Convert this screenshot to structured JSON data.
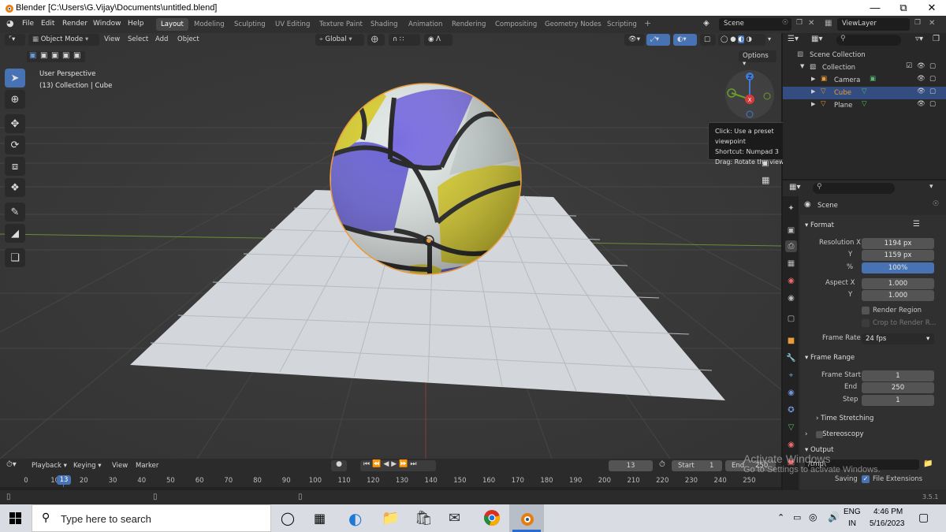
{
  "window": {
    "title": "Blender [C:\\Users\\G.Vijay\\Documents\\untitled.blend]"
  },
  "menu": [
    "File",
    "Edit",
    "Render",
    "Window",
    "Help"
  ],
  "workspaces": [
    "Layout",
    "Modeling",
    "Sculpting",
    "UV Editing",
    "Texture Paint",
    "Shading",
    "Animation",
    "Rendering",
    "Compositing",
    "Geometry Nodes",
    "Scripting"
  ],
  "active_workspace": "Layout",
  "scene_name": "Scene",
  "view_layer": "ViewLayer",
  "viewport": {
    "mode": "Object Mode",
    "menus": [
      "View",
      "Select",
      "Add",
      "Object"
    ],
    "transform_orientation": "Global",
    "options_label": "Options",
    "view_name": "User Perspective",
    "collection_info": "(13) Collection | Cube",
    "gizmo": {
      "x": "X",
      "y": "Y",
      "z": "Z"
    },
    "tooltip": [
      "Click: Use a preset viewpoint",
      "Shortcut: Numpad 3",
      "Drag: Rotate the view"
    ]
  },
  "outliner": {
    "rows": [
      {
        "label": "Scene Collection",
        "selected": false
      },
      {
        "label": "Collection",
        "selected": false
      },
      {
        "label": "Camera",
        "selected": false
      },
      {
        "label": "Cube",
        "selected": true
      },
      {
        "label": "Plane",
        "selected": false
      }
    ]
  },
  "properties": {
    "context": "Scene",
    "format_label": "Format",
    "resolution_x_label": "Resolution X",
    "resolution_x": "1194 px",
    "resolution_y_label": "Y",
    "resolution_y": "1159 px",
    "percent_label": "%",
    "percent": "100%",
    "aspect_x_label": "Aspect X",
    "aspect_x": "1.000",
    "aspect_y_label": "Y",
    "aspect_y": "1.000",
    "render_region": "Render Region",
    "crop_region": "Crop to Render R...",
    "frame_rate_label": "Frame Rate",
    "frame_rate": "24 fps",
    "frame_range_label": "Frame Range",
    "frame_start_label": "Frame Start",
    "frame_start": "1",
    "frame_end_label": "End",
    "frame_end": "250",
    "step_label": "Step",
    "step": "1",
    "time_stretching": "Time Stretching",
    "stereoscopy": "Stereoscopy",
    "output_label": "Output",
    "output_path": "/tmp\\",
    "saving_label": "Saving",
    "file_extensions": "File Extensions"
  },
  "timeline": {
    "menus": [
      "Playback",
      "Keying",
      "View",
      "Marker"
    ],
    "current_frame": "13",
    "start_label": "Start",
    "start": "1",
    "end_label": "End",
    "end": "250",
    "ticks": [
      "0",
      "10",
      "20",
      "30",
      "40",
      "50",
      "60",
      "70",
      "80",
      "90",
      "100",
      "110",
      "120",
      "130",
      "140",
      "150",
      "160",
      "170",
      "180",
      "190",
      "200",
      "210",
      "220",
      "230",
      "240",
      "250"
    ],
    "playhead": "13"
  },
  "status": {
    "version": "3.5.1"
  },
  "watermark": {
    "line1": "Activate Windows",
    "line2": "Go to Settings to activate Windows."
  },
  "taskbar": {
    "search_placeholder": "Type here to search",
    "lang": "ENG",
    "region": "IN",
    "time": "4:46 PM",
    "date": "5/16/2023"
  },
  "colors": {
    "accent": "#4772b3",
    "selection": "#334d80",
    "origin": "#e89b3c"
  }
}
